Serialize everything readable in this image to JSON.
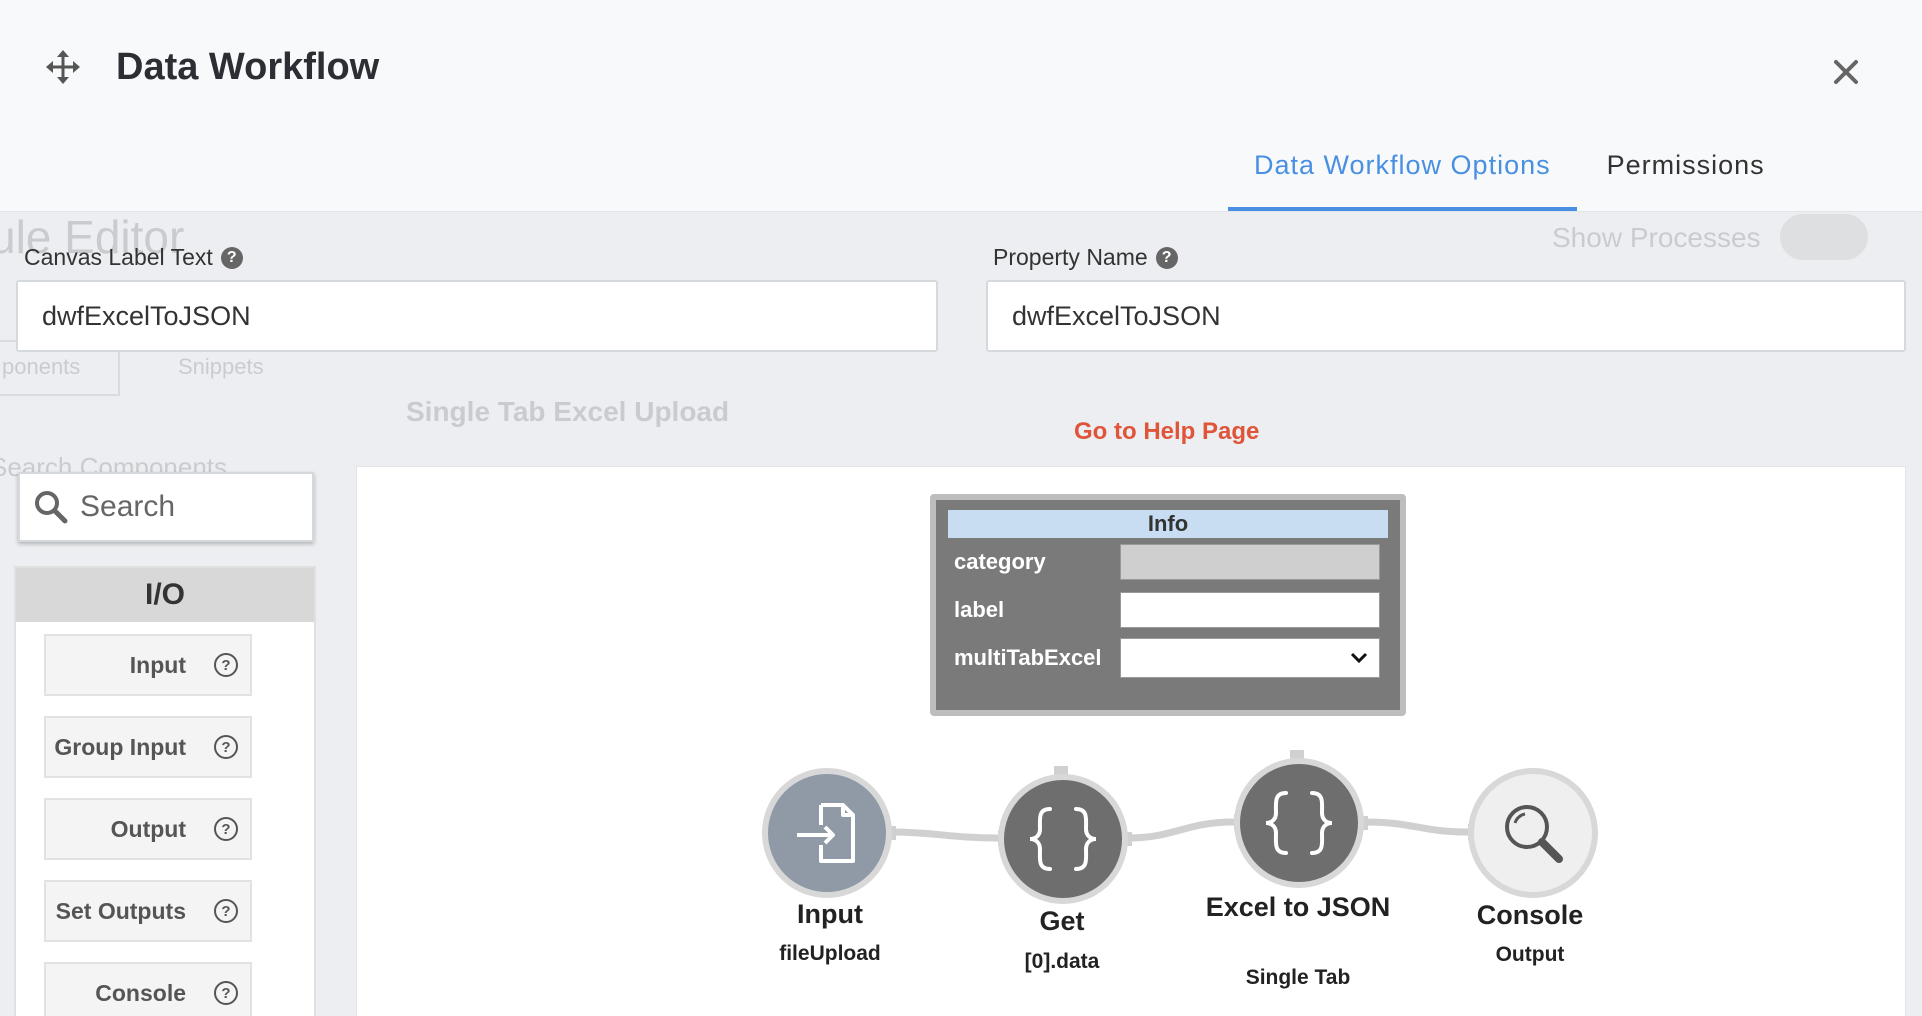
{
  "background": {
    "editor_title": "ule Editor",
    "show_processes_label": "Show Processes",
    "tabs": [
      "ponents",
      "Snippets"
    ],
    "search_placeholder": "Search Components",
    "page_heading": "Single Tab Excel Upload"
  },
  "modal": {
    "title": "Data Workflow",
    "tabs": [
      {
        "label": "Data Workflow Options",
        "active": true
      },
      {
        "label": "Permissions",
        "active": false
      }
    ]
  },
  "form": {
    "canvas_label": {
      "label": "Canvas Label Text",
      "value": "dwfExcelToJSON"
    },
    "property_name": {
      "label": "Property Name",
      "value": "dwfExcelToJSON"
    },
    "help_link": "Go to Help Page"
  },
  "sidebar": {
    "search_placeholder": "Search",
    "section_title": "I/O",
    "items": [
      {
        "label": "Input"
      },
      {
        "label": "Group Input"
      },
      {
        "label": "Output"
      },
      {
        "label": "Set Outputs"
      },
      {
        "label": "Console"
      }
    ]
  },
  "info_card": {
    "title": "Info",
    "rows": [
      {
        "label": "category",
        "value": ""
      },
      {
        "label": "label",
        "value": ""
      },
      {
        "label": "multiTabExcel",
        "value": ""
      }
    ]
  },
  "nodes": [
    {
      "title": "Input",
      "subtitle": "fileUpload",
      "icon": "file-import-icon"
    },
    {
      "title": "Get",
      "subtitle": "[0].data",
      "icon": "curly-braces-icon"
    },
    {
      "title": "Excel to JSON",
      "subtitle": "Single Tab",
      "icon": "curly-braces-icon"
    },
    {
      "title": "Console",
      "subtitle": "Output",
      "icon": "magnifier-icon"
    }
  ],
  "colors": {
    "accent": "#4a90e2",
    "help_link": "#e0553a",
    "node_dark": "#6e6e6e",
    "node_input": "#8f9aa6",
    "node_console": "#efefef"
  }
}
